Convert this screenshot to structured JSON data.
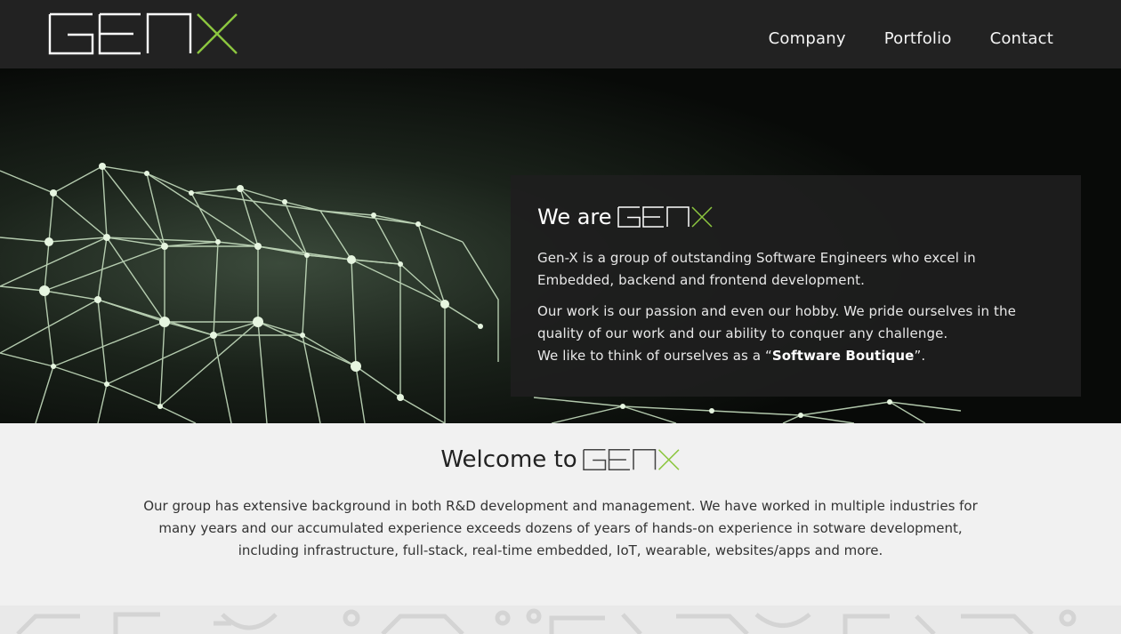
{
  "brand": {
    "logo_text": "GEN X",
    "accent_color": "#8cc63f",
    "logo_stroke_color": "#ffffff"
  },
  "nav": {
    "items": [
      {
        "label": "Company"
      },
      {
        "label": "Portfolio"
      },
      {
        "label": "Contact"
      }
    ]
  },
  "hero": {
    "title_prefix": "We are",
    "paragraph1": "Gen-X is a group of outstanding Software Engineers who excel in Embedded, backend and frontend development.",
    "paragraph2_line1": "Our work is our passion and even our hobby. We pride ourselves in the quality of our work and our ability to conquer any challenge.",
    "paragraph2_line2_prefix": "We like to think of ourselves as a  “",
    "paragraph2_strong": "Software Boutique",
    "paragraph2_suffix": "”.",
    "background_icon": "network-mesh-graphic"
  },
  "welcome": {
    "title_prefix": "Welcome to",
    "text": "Our group has extensive background in both R&D development and management. We have worked in multiple industries for many years and our accumulated experience exceeds dozens of years of hands-on experience in sotware development, including infrastructure, full-stack, real-time embedded, IoT, wearable, websites/apps and more."
  },
  "footer": {
    "pattern_icon": "circuit-pattern"
  }
}
